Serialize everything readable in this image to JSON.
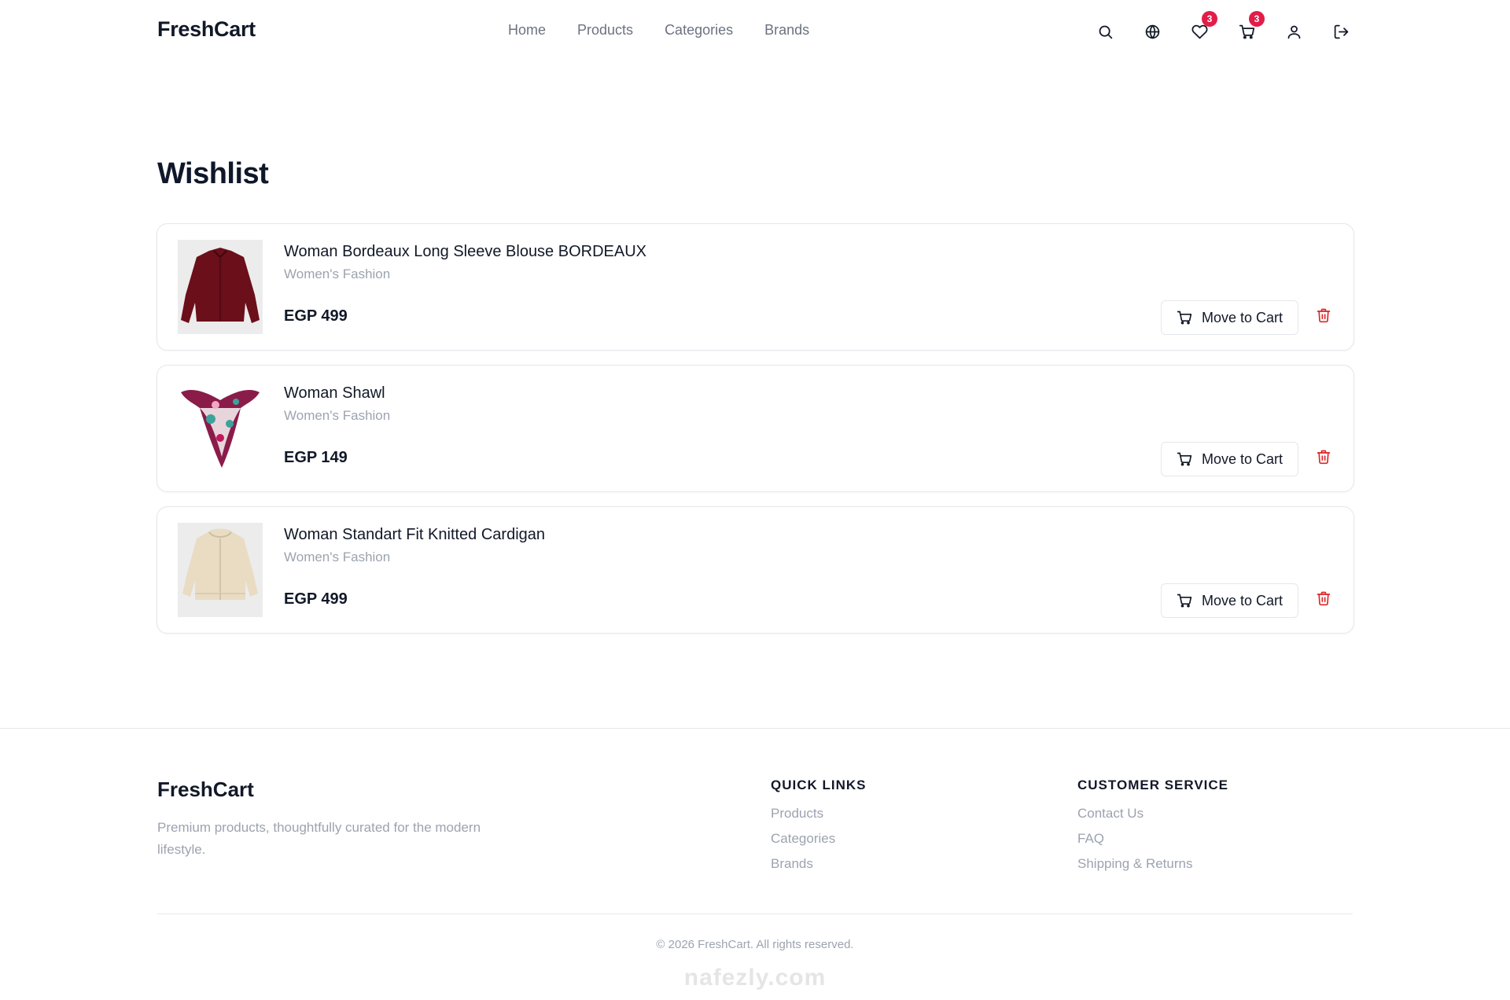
{
  "header": {
    "brand": "FreshCart",
    "nav": [
      "Home",
      "Products",
      "Categories",
      "Brands"
    ],
    "icons": {
      "search": "search-icon",
      "language": "globe-icon",
      "wishlist": "heart-icon",
      "cart": "cart-icon",
      "account": "user-icon",
      "logout": "logout-icon"
    },
    "wishlist_count": "3",
    "cart_count": "3",
    "badge_color": "#e11d48"
  },
  "page": {
    "title": "Wishlist"
  },
  "wishlist": {
    "move_label": "Move to Cart",
    "items": [
      {
        "name": "Woman Bordeaux Long Sleeve Blouse BORDEAUX",
        "category": "Women's Fashion",
        "price": "EGP 499",
        "thumb_icon": "blouse-image"
      },
      {
        "name": "Woman Shawl",
        "category": "Women's Fashion",
        "price": "EGP 149",
        "thumb_icon": "shawl-image"
      },
      {
        "name": "Woman Standart Fit Knitted Cardigan",
        "category": "Women's Fashion",
        "price": "EGP 499",
        "thumb_icon": "cardigan-image"
      }
    ],
    "delete_color": "#dc2626"
  },
  "footer": {
    "brand": "FreshCart",
    "description": "Premium products, thoughtfully curated for the modern lifestyle.",
    "quick_links": {
      "heading": "QUICK LINKS",
      "links": [
        "Products",
        "Categories",
        "Brands"
      ]
    },
    "customer_service": {
      "heading": "CUSTOMER SERVICE",
      "links": [
        "Contact Us",
        "FAQ",
        "Shipping & Returns"
      ]
    },
    "copyright": "© 2026 FreshCart. All rights reserved.",
    "watermark": "nafezly.com"
  }
}
